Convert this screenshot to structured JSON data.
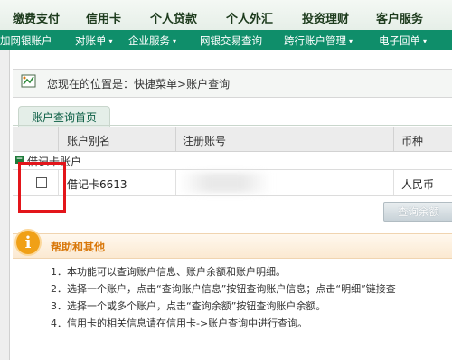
{
  "topnav": {
    "items": [
      "缴费支付",
      "信用卡",
      "个人贷款",
      "个人外汇",
      "投资理财",
      "客户服务"
    ]
  },
  "subnav": {
    "items": [
      {
        "label": "加网银账户",
        "has_menu": false
      },
      {
        "label": "对账单",
        "has_menu": true
      },
      {
        "label": "企业服务",
        "has_menu": true
      },
      {
        "label": "网银交易查询",
        "has_menu": false
      },
      {
        "label": "跨行账户管理",
        "has_menu": true
      },
      {
        "label": "电子回单",
        "has_menu": true
      }
    ],
    "chevron": "▾"
  },
  "breadcrumb": {
    "prefix": "您现在的位置是：",
    "path": "快捷菜单>账户查询"
  },
  "tab": {
    "label": "账户查询首页"
  },
  "table": {
    "headers": [
      "账户别名",
      "注册账号",
      "币种"
    ],
    "group": {
      "label": "借记卡账户",
      "toggle": "−"
    },
    "rows": [
      {
        "alias": "借记卡6613",
        "account": "",
        "currency": "人民币"
      }
    ]
  },
  "actions": {
    "query_balance": "查询余额"
  },
  "help": {
    "icon_glyph": "i",
    "title": "帮助和其他",
    "lines": [
      "1．本功能可以查询账户信息、账户余额和账户明细。",
      "2．选择一个账户，点击“查询账户信息”按钮查询账户信息；点击“明细”链接查",
      "3．选择一个或多个账户，点击“查询余额”按钮查询账户余额。",
      "4．信用卡的相关信息请在信用卡->账户查询中进行查询。"
    ]
  },
  "colors": {
    "accent_green": "#0f8e6a",
    "highlight_red": "#e3151a",
    "help_orange": "#f0a017"
  }
}
